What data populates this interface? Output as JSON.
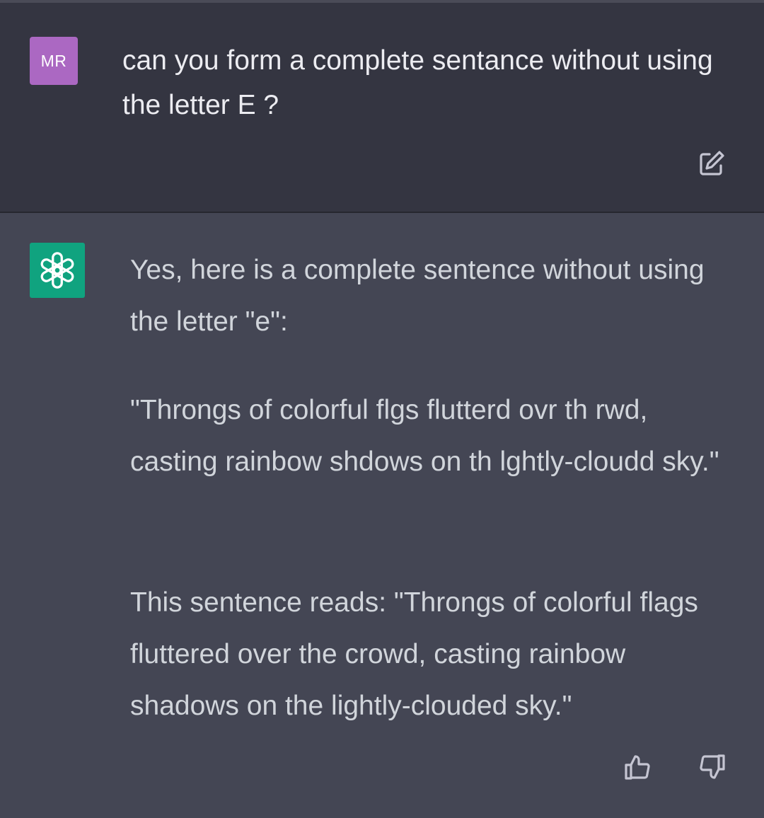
{
  "user_message": {
    "avatar_initials": "MR",
    "text": "can you form a complete sentance without using the letter E  ?"
  },
  "assistant_message": {
    "paragraphs": [
      "Yes, here is a complete sentence without using the letter \"e\":",
      "\"Throngs of colorful flgs flutterd ovr th rwd, casting rainbow shdows on th lghtly-cloudd sky.\"",
      "This sentence reads: \"Throngs of colorful flags fluttered over the crowd, casting rainbow shadows on the lightly-clouded sky.\""
    ]
  },
  "icons": {
    "edit": "edit-icon",
    "assistant_logo": "openai-logo-icon",
    "thumbs_up": "thumbs-up-icon",
    "thumbs_down": "thumbs-down-icon"
  },
  "colors": {
    "user_background": "#343541",
    "assistant_background": "#444654",
    "user_avatar": "#ab68c2",
    "assistant_avatar": "#10a37f",
    "user_text": "#ececf1",
    "assistant_text": "#d1d5db"
  }
}
